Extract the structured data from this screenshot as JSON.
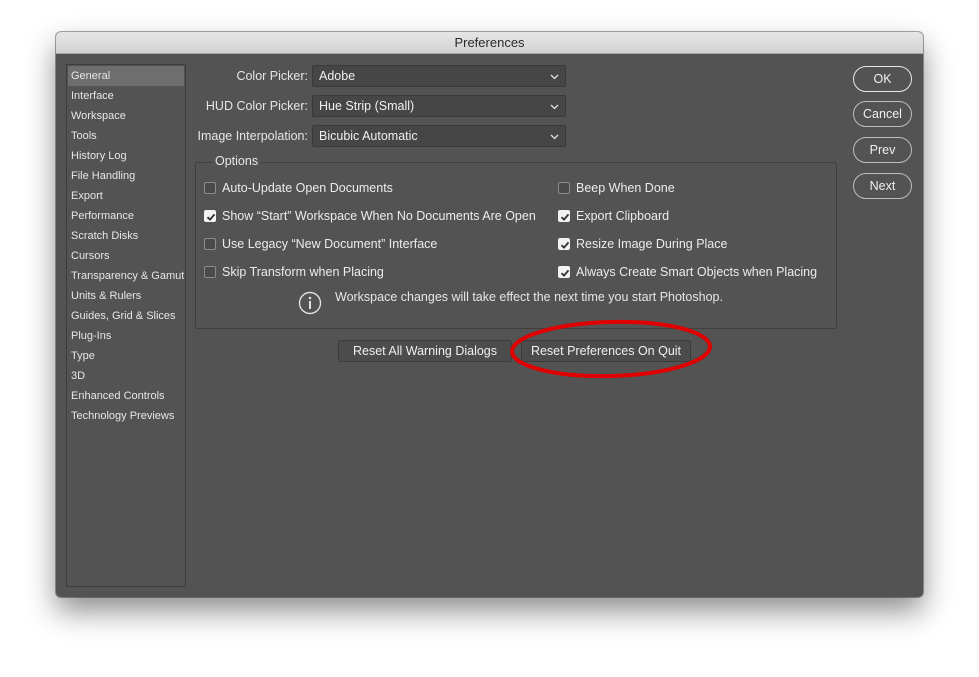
{
  "dialog": {
    "title": "Preferences"
  },
  "sidebar": {
    "items": [
      {
        "label": "General",
        "active": true
      },
      {
        "label": "Interface"
      },
      {
        "label": "Workspace"
      },
      {
        "label": "Tools"
      },
      {
        "label": "History Log"
      },
      {
        "label": "File Handling"
      },
      {
        "label": "Export"
      },
      {
        "label": "Performance"
      },
      {
        "label": "Scratch Disks"
      },
      {
        "label": "Cursors"
      },
      {
        "label": "Transparency & Gamut"
      },
      {
        "label": "Units & Rulers"
      },
      {
        "label": "Guides, Grid & Slices"
      },
      {
        "label": "Plug-Ins"
      },
      {
        "label": "Type"
      },
      {
        "label": "3D"
      },
      {
        "label": "Enhanced Controls"
      },
      {
        "label": "Technology Previews"
      }
    ]
  },
  "fields": {
    "color_picker": {
      "label": "Color Picker:",
      "value": "Adobe"
    },
    "hud_color_picker": {
      "label": "HUD Color Picker:",
      "value": "Hue Strip (Small)"
    },
    "image_interpolation": {
      "label": "Image Interpolation:",
      "value": "Bicubic Automatic"
    }
  },
  "options": {
    "title": "Options",
    "left": [
      {
        "label": "Auto-Update Open Documents",
        "checked": false
      },
      {
        "label": "Show “Start” Workspace When No Documents Are Open",
        "checked": true
      },
      {
        "label": "Use Legacy “New Document” Interface",
        "checked": false
      },
      {
        "label": "Skip Transform when Placing",
        "checked": false
      }
    ],
    "right": [
      {
        "label": "Beep When Done",
        "checked": false
      },
      {
        "label": "Export Clipboard",
        "checked": true
      },
      {
        "label": "Resize Image During Place",
        "checked": true
      },
      {
        "label": "Always Create Smart Objects when Placing",
        "checked": true
      }
    ],
    "info_text": "Workspace changes will take effect the next time you start Photoshop."
  },
  "buttons": {
    "reset_warnings": "Reset All Warning Dialogs",
    "reset_prefs": "Reset Preferences On Quit",
    "ok": "OK",
    "cancel": "Cancel",
    "prev": "Prev",
    "next": "Next"
  },
  "colors": {
    "dialog_bg": "#535353",
    "annotation": "#e00000"
  }
}
